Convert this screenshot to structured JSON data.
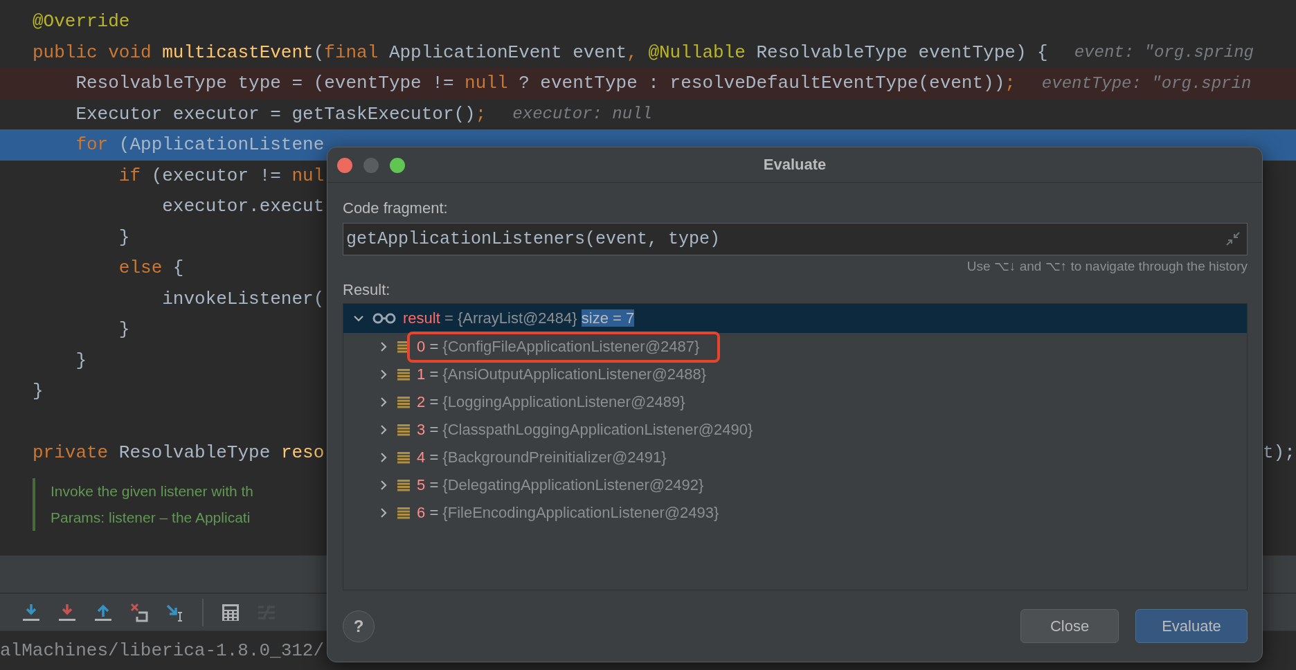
{
  "editor": {
    "lines": [
      {
        "kind": "normal",
        "segments": [
          {
            "kind": "annotation",
            "text": "@Override"
          }
        ]
      },
      {
        "kind": "normal",
        "segments": [
          {
            "kind": "keyword",
            "text": "public void "
          },
          {
            "kind": "method",
            "text": "multicastEvent"
          },
          {
            "kind": "plain",
            "text": "("
          },
          {
            "kind": "keyword",
            "text": "final "
          },
          {
            "kind": "plain",
            "text": "ApplicationEvent event"
          },
          {
            "kind": "keyword",
            "text": ", "
          },
          {
            "kind": "annotation",
            "text": "@Nullable "
          },
          {
            "kind": "plain",
            "text": "ResolvableType eventType) {"
          },
          {
            "kind": "hint",
            "text": "event: \"org.spring"
          }
        ]
      },
      {
        "kind": "breakpoint",
        "segments": [
          {
            "kind": "plain",
            "text": "    ResolvableType type = (eventType != "
          },
          {
            "kind": "keyword",
            "text": "null"
          },
          {
            "kind": "plain",
            "text": " ? eventType : resolveDefaultEventType(event))"
          },
          {
            "kind": "keyword",
            "text": ";"
          },
          {
            "kind": "hint",
            "text": "eventType: \"org.sprin"
          }
        ]
      },
      {
        "kind": "normal",
        "segments": [
          {
            "kind": "plain",
            "text": "    Executor executor = getTaskExecutor()"
          },
          {
            "kind": "keyword",
            "text": ";"
          },
          {
            "kind": "hint",
            "text": "executor: null"
          }
        ]
      },
      {
        "kind": "execution",
        "segments": [
          {
            "kind": "keyword",
            "text": "    for "
          },
          {
            "kind": "plain",
            "text": "(ApplicationListene"
          }
        ]
      },
      {
        "kind": "normal",
        "segments": [
          {
            "kind": "keyword",
            "text": "        if "
          },
          {
            "kind": "plain",
            "text": "(executor != "
          },
          {
            "kind": "keyword",
            "text": "nul"
          }
        ]
      },
      {
        "kind": "normal",
        "segments": [
          {
            "kind": "plain",
            "text": "            executor.execut"
          }
        ]
      },
      {
        "kind": "normal",
        "segments": [
          {
            "kind": "plain",
            "text": "        }"
          }
        ]
      },
      {
        "kind": "normal",
        "segments": [
          {
            "kind": "keyword",
            "text": "        else "
          },
          {
            "kind": "plain",
            "text": "{"
          }
        ]
      },
      {
        "kind": "normal",
        "segments": [
          {
            "kind": "plain",
            "text": "            invokeListener("
          }
        ]
      },
      {
        "kind": "normal",
        "segments": [
          {
            "kind": "plain",
            "text": "        }"
          }
        ]
      },
      {
        "kind": "normal",
        "segments": [
          {
            "kind": "plain",
            "text": "    }"
          }
        ]
      },
      {
        "kind": "normal",
        "segments": [
          {
            "kind": "plain",
            "text": "}"
          }
        ]
      },
      {
        "kind": "normal"
      },
      {
        "kind": "normal",
        "segments": [
          {
            "kind": "keyword",
            "text": "private "
          },
          {
            "kind": "plain",
            "text": "ResolvableType "
          },
          {
            "kind": "method",
            "text": "reso"
          }
        ],
        "tail": "t);"
      }
    ],
    "doc_comment": [
      "Invoke the given listener with th",
      "Params: listener – the Applicati"
    ]
  },
  "debug_toolbar": [
    {
      "kind": "stepover",
      "disabled": false
    },
    {
      "kind": "stepinto",
      "disabled": false
    },
    {
      "kind": "stepout",
      "disabled": false
    },
    {
      "kind": "dropframe",
      "disabled": false
    },
    {
      "kind": "runtocursor",
      "disabled": false
    },
    {
      "kind": "evaluate",
      "disabled": false
    },
    {
      "kind": "trace",
      "disabled": true
    }
  ],
  "path": "alMachines/liberica-1.8.0_312/",
  "dialog": {
    "title": "Evaluate",
    "code_fragment_label": "Code fragment:",
    "code_fragment": "getApplicationListeners(event, type)",
    "history_hint": "Use ⌥↓ and ⌥↑ to navigate through the history",
    "result_label": "Result:",
    "result": {
      "name": "result",
      "operator": "=",
      "value": "{ArrayList@2484}",
      "extra": "size = 7",
      "expanded": true,
      "selected": true,
      "children": [
        {
          "name": "0",
          "operator": "=",
          "value": "{ConfigFileApplicationListener@2487}",
          "expanded": false,
          "selected": false,
          "annotated": true
        },
        {
          "name": "1",
          "operator": "=",
          "value": "{AnsiOutputApplicationListener@2488}",
          "expanded": false,
          "selected": false,
          "annotated": false
        },
        {
          "name": "2",
          "operator": "=",
          "value": "{LoggingApplicationListener@2489}",
          "expanded": false,
          "selected": false,
          "annotated": false
        },
        {
          "name": "3",
          "operator": "=",
          "value": "{ClasspathLoggingApplicationListener@2490}",
          "expanded": false,
          "selected": false,
          "annotated": false
        },
        {
          "name": "4",
          "operator": "=",
          "value": "{BackgroundPreinitializer@2491}",
          "expanded": false,
          "selected": false,
          "annotated": false
        },
        {
          "name": "5",
          "operator": "=",
          "value": "{DelegatingApplicationListener@2492}",
          "expanded": false,
          "selected": false,
          "annotated": false
        },
        {
          "name": "6",
          "operator": "=",
          "value": "{FileEncodingApplicationListener@2493}",
          "expanded": false,
          "selected": false,
          "annotated": false
        }
      ]
    },
    "help": "?",
    "buttons": [
      {
        "label": "Close",
        "kind": "secondary"
      },
      {
        "label": "Evaluate",
        "kind": "primary"
      }
    ]
  }
}
